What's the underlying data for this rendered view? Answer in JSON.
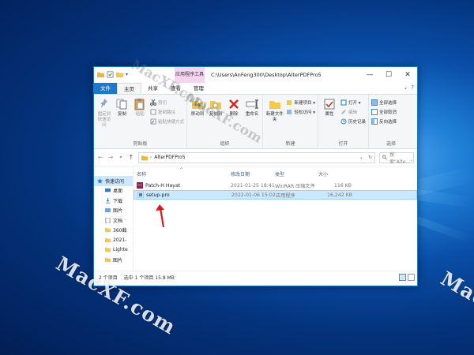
{
  "watermark": {
    "main": "MacXF.com",
    "overlay_1": "MacXF.com",
    "overlay_2": "MacXF.com",
    "right_edge": "Mac"
  },
  "window": {
    "context_tab": "应用程序工具",
    "title_path": "C:\\Users\\AnFeng300\\Desktop\\AlterPDFPro5",
    "controls": {
      "minimize": "—",
      "maximize": "☐",
      "close": "✕"
    }
  },
  "tabs": {
    "file": "文件",
    "home": "主页",
    "share": "共享",
    "view": "查看",
    "manage": "管理"
  },
  "ribbon": {
    "clipboard": {
      "pin": "固定到快速访问",
      "copy": "复制",
      "paste": "粘贴",
      "cut": "剪切",
      "copy_path": "复制路径",
      "paste_shortcut": "粘贴快捷方式",
      "label": "剪贴板"
    },
    "organize": {
      "move_to": "移动到",
      "copy_to": "复制到",
      "delete": "删除",
      "rename": "重命名",
      "label": "组织"
    },
    "new": {
      "new_folder": "新建文件夹",
      "new_item": "新建项目 ▾",
      "easy_access": "轻松访问 ▾",
      "label": "新建"
    },
    "open": {
      "properties": "属性",
      "open": "打开 ▾",
      "edit": "编辑",
      "history": "历史记录",
      "label": "打开"
    },
    "select": {
      "select_all": "全部选择",
      "select_none": "全部取消",
      "invert": "反向选择",
      "label": "选择"
    }
  },
  "address": {
    "back": "←",
    "forward": "→",
    "up": "↑",
    "path": "AlterPDFPro5",
    "search_placeholder": "搜索\"Alte...\""
  },
  "navpane": {
    "items": [
      "快速访问",
      "桌面",
      "下载",
      "图片",
      "文档",
      "360截",
      "2021-",
      "Lighte",
      "图片"
    ]
  },
  "columns": {
    "name": "名称",
    "date": "修改日期",
    "type": "类型",
    "size": "大小"
  },
  "files": [
    {
      "name": "Patch-H Hayat",
      "date": "2021-01-25 18:41",
      "type": "WinRAR 压缩文件",
      "size": "116 KB"
    },
    {
      "name": "setup-pro",
      "date": "2022-01-06 15:02",
      "type": "应用程序",
      "size": "16,242 KB"
    }
  ],
  "status": {
    "count": "2 个项目",
    "selected": "选中 1 个项目 15.8 MB"
  },
  "colors": {
    "accent": "#1979ca",
    "selection": "#cce8ff",
    "context_tab": "#f4d4ef",
    "arrow": "#e0161b"
  }
}
